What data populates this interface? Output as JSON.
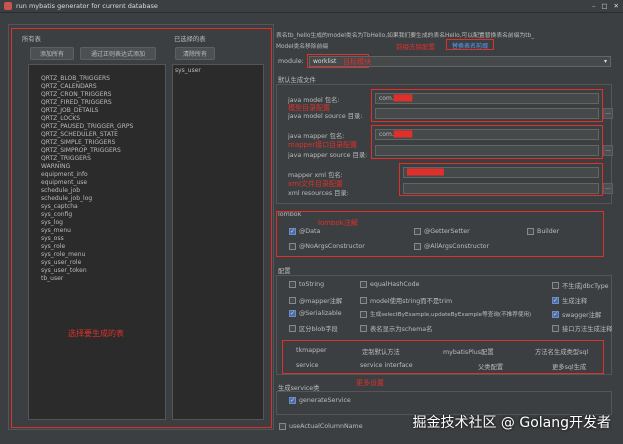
{
  "window": {
    "title": "run mybatis generator for current database"
  },
  "left": {
    "all_tables_label": "所有表",
    "selected_tables_label": "已选择的表",
    "add_all_button": "添加所有",
    "add_by_regex_button": "通过正则表达式添加",
    "remove_all_button": "清除所有",
    "tables": [
      "QRTZ_BLOB_TRIGGERS",
      "QRTZ_CALENDARS",
      "QRTZ_CRON_TRIGGERS",
      "QRTZ_FIRED_TRIGGERS",
      "QRTZ_JOB_DETAILS",
      "QRTZ_LOCKS",
      "QRTZ_PAUSED_TRIGGER_GRPS",
      "QRTZ_SCHEDULER_STATE",
      "QRTZ_SIMPLE_TRIGGERS",
      "QRTZ_SIMPROP_TRIGGERS",
      "QRTZ_TRIGGERS",
      "WARNING",
      "equipment_info",
      "equipment_use",
      "schedule_job",
      "schedule_job_log",
      "sys_captcha",
      "sys_config",
      "sys_log",
      "sys_menu",
      "sys_oss",
      "sys_role",
      "sys_role_menu",
      "sys_user_role",
      "sys_user_token",
      "tb_user"
    ],
    "selected_tables": [
      "sys_user"
    ],
    "annotation": "选择要生成的表"
  },
  "right": {
    "hint_line1": "表名tb_hello生成的model类名为TbHello,如果我们要生成的表名Hello,可以配置替换表名前缀为tb_",
    "hint_line2": "Model类名移除前缀",
    "hint_annotation": "前缀去除配置",
    "hint_link": "替换表名前缀",
    "module_label": "module:",
    "module_value": "worklist",
    "module_annotation": "目标模块",
    "default_files_label": "默认生成文件",
    "model_package_label": "java model 包名:",
    "model_package_value": "com.",
    "model_source_label": "java model source 目录:",
    "model_annotation": "模型目录配置",
    "mapper_package_label": "java mapper 包名:",
    "mapper_package_value": "com.",
    "mapper_source_label": "java mapper source 目录:",
    "mapper_annotation": "mapper接口目录配置",
    "xml_package_label": "mapper xml 包名:",
    "xml_source_label": "xml resources 目录:",
    "xml_annotation": "xml文件目录配置",
    "dot_button": "...",
    "lombok": {
      "title": "lombok",
      "annotation": "lombok注解",
      "options": [
        {
          "label": "@Data",
          "checked": true
        },
        {
          "label": "@GetterSetter",
          "checked": false
        },
        {
          "label": "Builder",
          "checked": false
        },
        {
          "label": "@NoArgsConstructor",
          "checked": false
        },
        {
          "label": "@AllArgsConstructor",
          "checked": false
        }
      ]
    },
    "config": {
      "title": "配置",
      "options": [
        {
          "label": "toString",
          "checked": false
        },
        {
          "label": "equalHashCode",
          "checked": false
        },
        {
          "label": "不生成jdbcType",
          "checked": false
        },
        {
          "label": "@mapper注解",
          "checked": false
        },
        {
          "label": "model使用string而不是trim",
          "checked": false
        },
        {
          "label": "生成注释",
          "checked": true
        },
        {
          "label": "@Serializable",
          "checked": true
        },
        {
          "label": "生成selectByExample,updateByExample等查询(不推荐使用)",
          "checked": false
        },
        {
          "label": "swagger注解",
          "checked": true
        },
        {
          "label": "区分blob字段",
          "checked": false
        },
        {
          "label": "表名显示为schema名",
          "checked": false
        },
        {
          "label": "接口方法生成注释",
          "checked": false
        }
      ]
    },
    "tabs": {
      "row1": [
        "tkmapper",
        "定制默认方法",
        "mybatisPlus配置",
        "方法名生成类型sql"
      ],
      "row2": [
        "service",
        "service interface",
        "父类配置",
        "更多sql生成"
      ],
      "annotation": "更多设置"
    },
    "service": {
      "title": "生成service类",
      "option": {
        "label": "generateService",
        "checked": true
      }
    },
    "bottom_option": {
      "label": "useActualColumnName",
      "checked": false
    }
  },
  "watermark": "掘金技术社区 @ Golang开发者"
}
